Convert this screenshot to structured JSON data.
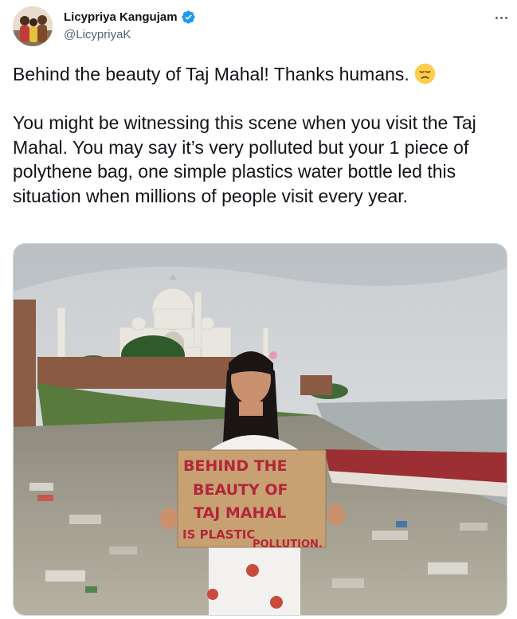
{
  "author": {
    "name": "Licypriya Kangujam",
    "handle": "@LicypriyaK",
    "verified": true
  },
  "tweet": {
    "line1": "Behind the beauty of Taj Mahal! Thanks humans.",
    "emoji": "disappointed-face-emoji",
    "body": "You might be witnessing this scene when you visit the Taj Mahal. You may say it’s very polluted but your 1 piece of polythene bag, one simple plastics water bottle led this situation when millions of people visit every year."
  },
  "media": {
    "sign_lines": [
      "BEHIND THE",
      "BEAUTY OF",
      "TAJ MAHAL",
      "IS PLASTIC",
      "POLLUTION."
    ]
  },
  "colors": {
    "verified": "#1d9bf0",
    "secondary_text": "#536471",
    "primary_text": "#0f1419",
    "sign_ink": "#b3263a",
    "cardboard": "#c8a173"
  }
}
